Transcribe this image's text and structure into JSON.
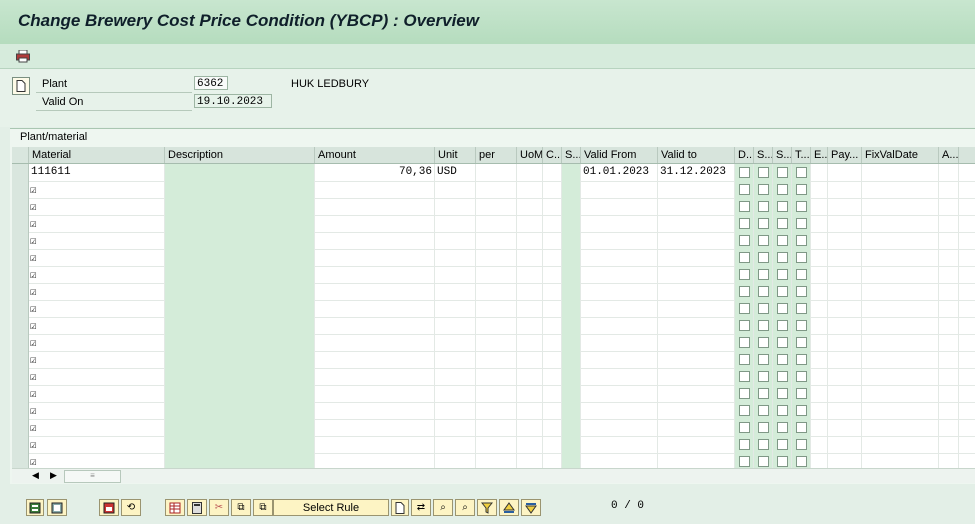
{
  "title": "Change Brewery Cost Price Condition (YBCP) : Overview",
  "toolbar": {
    "print_icon": "printer-icon"
  },
  "header": {
    "plant_label": "Plant",
    "plant_value": "6362",
    "plant_name": "HUK LEDBURY",
    "valid_on_label": "Valid On",
    "valid_on_value": "19.10.2023"
  },
  "panel": {
    "caption": "Plant/material"
  },
  "table": {
    "columns": [
      "Material",
      "Description",
      "Amount",
      "Unit",
      "per",
      "UoM",
      "C...",
      "S...",
      "Valid From",
      "Valid to",
      "D...",
      "S...",
      "S...",
      "T...",
      "E...",
      "Pay...",
      "FixValDate",
      "A..."
    ],
    "rows": [
      {
        "material": "111611",
        "description": "",
        "amount": "70,36",
        "unit": "USD",
        "per": "",
        "uom": "",
        "valid_from": "01.01.2023",
        "valid_to": "31.12.2023"
      }
    ],
    "empty_rows": 17
  },
  "footer": {
    "select_rule_label": "Select Rule",
    "counter": "0  /  0"
  },
  "colors": {
    "title_bg": "#c8e6cf",
    "panel_bg": "#eef6f0",
    "button_bg": "#fdf4c4"
  }
}
